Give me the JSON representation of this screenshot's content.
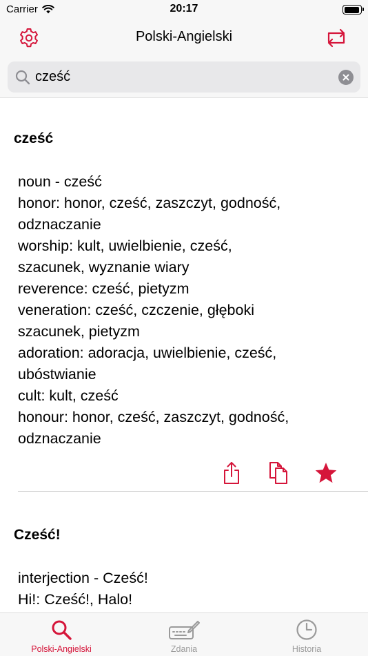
{
  "status": {
    "carrier": "Carrier",
    "time": "20:17",
    "battery_level": 0.92
  },
  "nav": {
    "title": "Polski-Angielski",
    "settings_icon": "gear-icon",
    "swap_icon": "swap-languages-icon"
  },
  "search": {
    "value": "cześć",
    "placeholder": ""
  },
  "entries": [
    {
      "headword": "cześć",
      "lines": [
        "noun - cześć",
        "honor: honor, cześć, zaszczyt, godność,",
        "odznaczanie",
        "worship: kult, uwielbienie, cześć,",
        "szacunek, wyznanie wiary",
        "reverence: cześć, pietyzm",
        "veneration: cześć, czczenie, głęboki",
        "szacunek, pietyzm",
        "adoration: adoracja, uwielbienie, cześć,",
        "ubóstwianie",
        "cult: kult, cześć",
        "honour: honor, cześć, zaszczyt, godność,",
        "odznaczanie"
      ]
    },
    {
      "headword": "Cześć!",
      "lines": [
        "interjection - Cześć!",
        "Hi!: Cześć!, Halo!"
      ]
    }
  ],
  "actions": {
    "share_icon": "share-icon",
    "copy_icon": "copy-icon",
    "favorite_icon": "star-icon"
  },
  "tabs": [
    {
      "label": "Polski-Angielski",
      "icon": "search-icon",
      "active": true
    },
    {
      "label": "Zdania",
      "icon": "keyboard-pen-icon",
      "active": false
    },
    {
      "label": "Historia",
      "icon": "clock-icon",
      "active": false
    }
  ],
  "colors": {
    "accent": "#d5153a",
    "inactive": "#9a9a9a",
    "bar_bg": "#f7f7f7"
  }
}
